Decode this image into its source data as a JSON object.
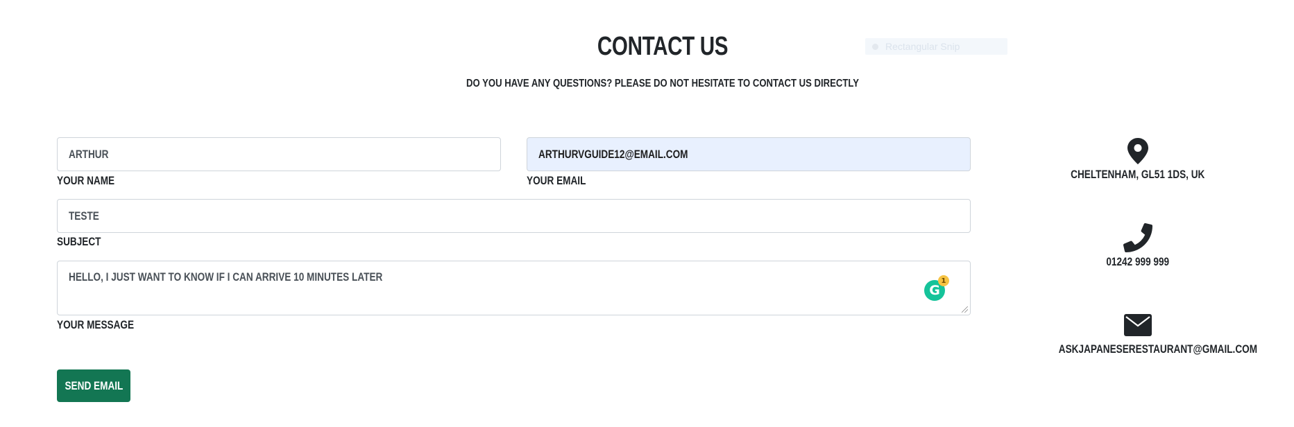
{
  "header": {
    "title": "CONTACT US",
    "subtitle": "DO YOU HAVE ANY QUESTIONS? PLEASE DO NOT HESITATE TO CONTACT US DIRECTLY"
  },
  "snip_overlay": {
    "label": "Rectangular Snip"
  },
  "form": {
    "name": {
      "value": "ARTHUR",
      "label": "YOUR NAME"
    },
    "email": {
      "value": "ARTHURVGUIDE12@EMAIL.COM",
      "label": "YOUR EMAIL"
    },
    "subject": {
      "value": "TESTE",
      "label": "SUBJECT"
    },
    "message": {
      "value": "HELLO, I JUST WANT TO KNOW IF I CAN ARRIVE 10 MINUTES LATER",
      "label": "YOUR MESSAGE"
    },
    "grammarly": {
      "glyph": "G",
      "badge_count": "1"
    },
    "send_label": "SEND EMAIL"
  },
  "contact_info": {
    "address": {
      "icon": "map-pin-icon",
      "text": "CHELTENHAM, GL51 1DS, UK"
    },
    "phone": {
      "icon": "phone-icon",
      "text": "01242 999 999"
    },
    "email": {
      "icon": "envelope-icon",
      "text": "ASKJAPANESERESTAURANT@GMAIL.COM"
    }
  },
  "colors": {
    "button_bg": "#137653",
    "autofill_bg": "#e8f0fe",
    "text": "#212529",
    "grammarly": "#15c39a"
  }
}
